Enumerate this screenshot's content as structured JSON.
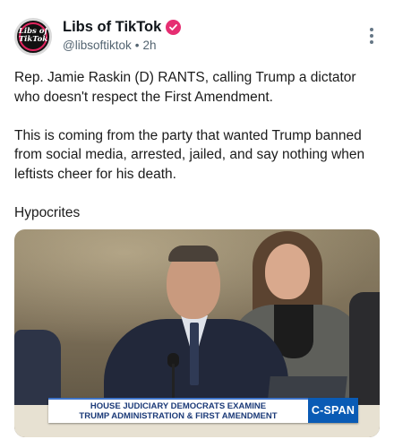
{
  "post": {
    "avatar": {
      "line1": "Libs of",
      "line2": "TikTok"
    },
    "display_name": "Libs of TikTok",
    "verified_badge_color": "#e62e72",
    "handle": "@libsoftiktok",
    "separator": "•",
    "time": "2h",
    "more_icon": "vertical-ellipsis-icon",
    "paragraphs": [
      "Rep. Jamie Raskin (D) RANTS, calling Trump a dictator who doesn't respect the First Amendment.",
      "This is coming from the party that wanted Trump banned from social media, arrested, jailed, and say nothing when leftists cheer for his death.",
      "Hypocrites"
    ],
    "media": {
      "chyron_line1": "HOUSE JUDICIARY DEMOCRATS EXAMINE",
      "chyron_line2": "TRUMP ADMINISTRATION & FIRST AMENDMENT",
      "brand": "C-SPAN"
    }
  }
}
